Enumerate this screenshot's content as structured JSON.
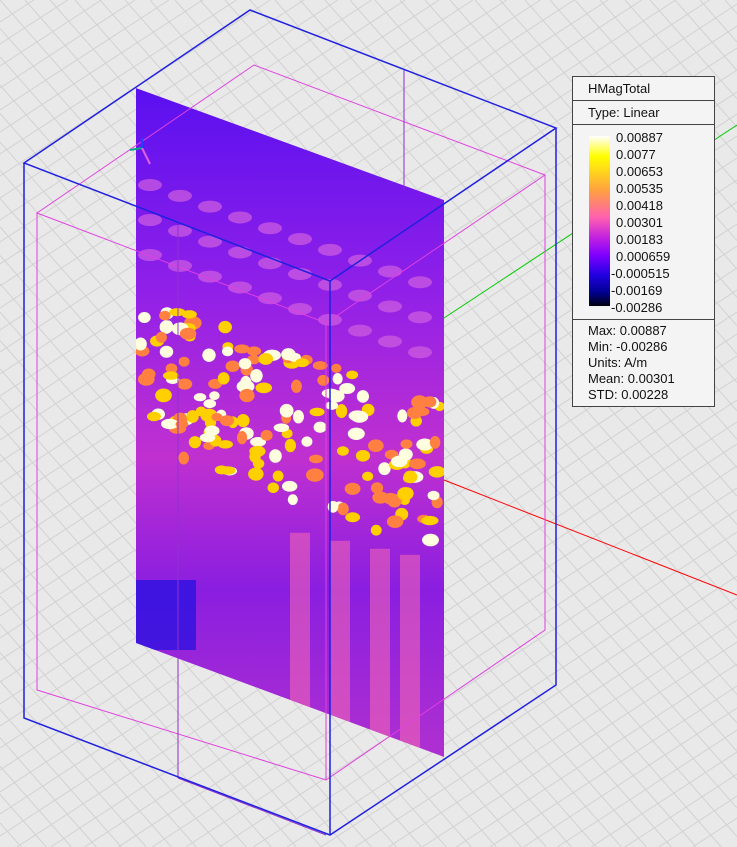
{
  "legend": {
    "title": "HMagTotal",
    "type": "Type: Linear",
    "ticks": [
      "0.00887",
      "0.0077",
      "0.00653",
      "0.00535",
      "0.00418",
      "0.00301",
      "0.00183",
      "0.000659",
      "-0.000515",
      "-0.00169",
      "-0.00286"
    ],
    "stats": {
      "max": "Max: 0.00887",
      "min": "Min: -0.00286",
      "units": "Units: A/m",
      "mean": "Mean: 0.00301",
      "std": "STD: 0.00228"
    }
  },
  "colors": {
    "box_outer": "#2020e0",
    "box_inner": "#e040e0",
    "axis_x": "#ff0000",
    "axis_y": "#00cc00"
  }
}
